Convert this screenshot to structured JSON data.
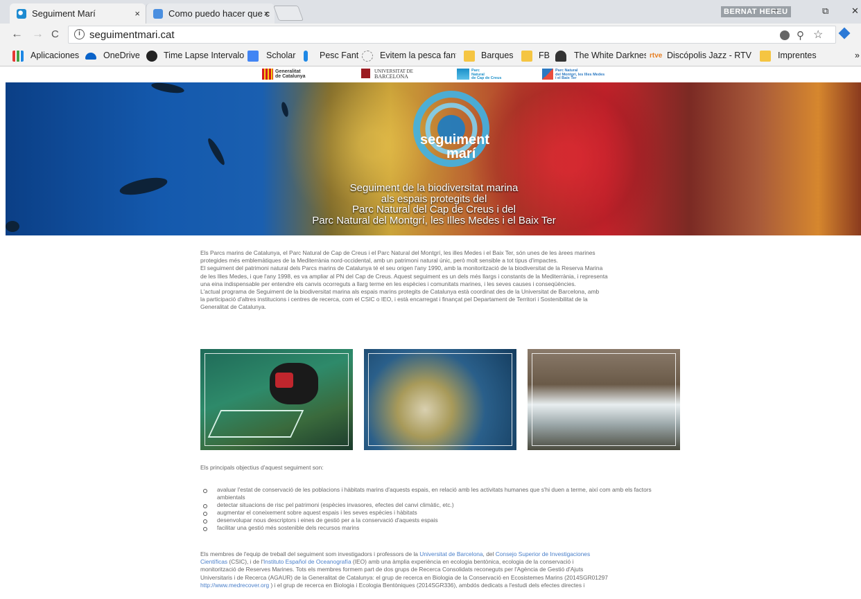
{
  "browser": {
    "tabs": [
      {
        "title": "Seguiment Marí",
        "close": "×"
      },
      {
        "title": "Como puedo hacer que c",
        "close": "×"
      }
    ],
    "profile": "BERNAT HEREU",
    "window_controls": {
      "minimize": "–",
      "restore": "⧉",
      "close": "✕"
    },
    "nav": {
      "back": "←",
      "forward": "→",
      "reload": "C"
    },
    "url": "seguimentmari.cat",
    "info_glyph": "i",
    "bookmarks": [
      "Aplicaciones",
      "OneDrive",
      "Time Lapse Intervalo",
      "Scholar",
      "Pesc Fant",
      "Evitem la pesca fanta",
      "Barques",
      "FB",
      "The White Darkness",
      "rtve",
      "Discópolis Jazz - RTV",
      "Imprentes",
      "»"
    ]
  },
  "logos": [
    {
      "line1": "Generalitat",
      "line2": "de Catalunya",
      "mark_color": "#d4181f"
    },
    {
      "line1": "UNIVERSITAT DE",
      "line2": "BARCELONA",
      "mark_color": "#9b1b21"
    },
    {
      "line1": "Parc",
      "line2": "Natural",
      "line3": "de Cap de Creus",
      "mark_color": "#1a8fc9"
    },
    {
      "line1": "Parc Natural",
      "line2": "del Montgrí, les Illes Medes",
      "line3": "i el Baix Ter",
      "mark_color": "#2b79c2"
    }
  ],
  "hero": {
    "logo_line1": "seguiment",
    "logo_line2": "marí",
    "title_lines": [
      "Seguiment de la biodiversitat marina",
      "als espais protegits del",
      "Parc Natural del Cap de Creus i del",
      "Parc Natural del Montgrí, les Illes Medes i el Baix Ter"
    ]
  },
  "intro": {
    "p1_lines": [
      "Els Parcs marins de Catalunya, el Parc Natural de Cap de Creus i el Parc Natural del Montgrí, les illes Medes i el Baix Ter, són unes de les àrees marines",
      "protegides més emblemàtiques de la Mediterrània nord-occidental, amb un patrimoni natural únic, però molt sensible a tot tipus d'impactes.",
      "El seguiment del patrimoni natural dels Parcs marins de Catalunya té el seu origen l'any 1990, amb la monitorització de la biodiversitat de la Reserva Marina",
      "de les Illes Medes, i que l'any 1998, es va ampliar al PN del Cap de Creus. Aquest seguiment es un dels més llargs i constants de la Mediterrània, i representa",
      "una eina indispensable per entendre els canvis ocorreguts a llarg terme en les espècies i comunitats marines, i les seves causes i conseqüències.",
      "L'actual programa de Seguiment de la biodiversitat marina als espais marins protegits de Catalunya està coordinat des de la Universitat de Barcelona, amb",
      "la participació d'altres institucions i centres de recerca, com el CSIC o IEO, i està encarregat i finançat pel Departament de Territori i Sostenibilitat de la",
      "Generalitat de Catalunya."
    ]
  },
  "objectives_intro": "Els principals objectius d'aquest seguiment son:",
  "objectives": [
    "avaluar l'estat de conservació de les poblacions i hàbitats marins d'aquests espais, en relació amb les activitats humanes que s'hi duen a terme, així com amb els factors ambientals",
    "detectar situacions de risc pel patrimoni (espècies invasores, efectes del canvi climàtic, etc.)",
    "augmentar el coneixement sobre aquest espais i les seves espècies i hàbitats",
    "desenvolupar nous descriptors i eines de gestió per a la conservació d'aquests espais",
    "facilitar una gestió més sostenible dels recursos marins"
  ],
  "team": {
    "l1_a": "Els membres de l'equip de treball del seguiment som investigadors i professors de la ",
    "l1_link1": "Universitat de Barcelona",
    "l1_b": ", del ",
    "l1_link2": "Consejo Superior de Investigaciones",
    "l2_link2": "Científicas",
    "l2_a": " (CSIC), i de l'",
    "l2_link3": "Instituto Español de Oceanografía",
    "l2_b": " (IEO) amb una àmplia experiència en ecologia bentònica, ecologia de la conservació i",
    "l3": "monitorització de Reserves Marines. Tots els membres formem part de dos grups de Recerca Consolidats reconeguts per l'Agència de Gestió d'Ajuts",
    "l4": "Universitaris i de Recerca (AGAUR) de la Generalitat de Catalunya: el grup de recerca en Biologia de la Conservació en Ecosistemes Marins (2014SGR01297",
    "l5_link": "http://www.medrecover.org",
    "l5_a": " ) i el grup de recerca en Biologia i Ecologia Bentòniques (2014SGR336), ambdós dedicats a l'estudi dels efectes directes i"
  },
  "colors": {
    "accent_link": "#4a7fc9",
    "tabbar": "#dee1e6",
    "toolbar": "#f2f2f2"
  }
}
